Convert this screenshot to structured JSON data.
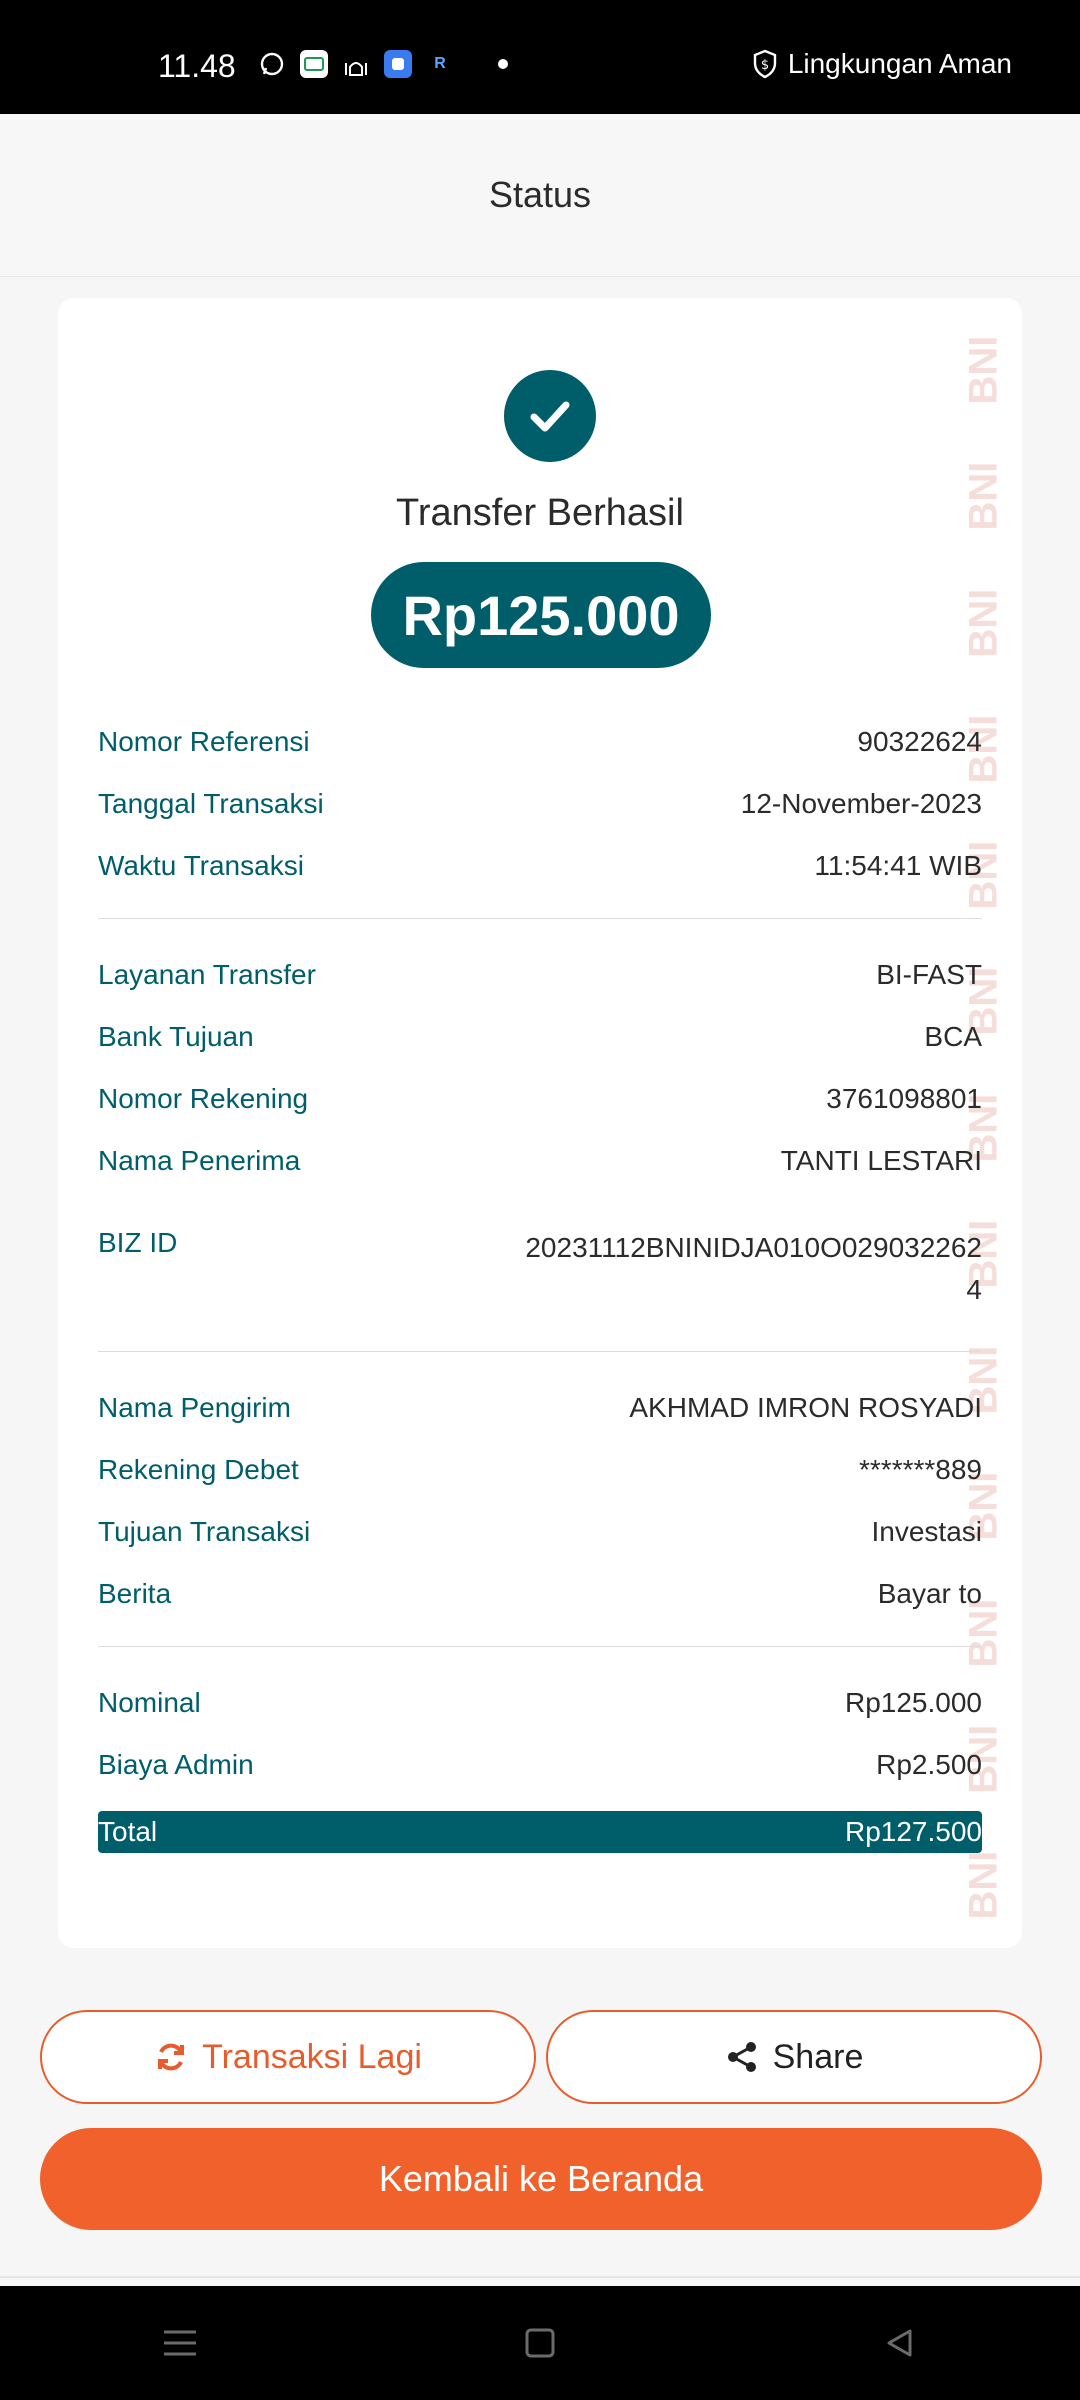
{
  "status_bar": {
    "time": "11.48",
    "right_text": "Lingkungan Aman",
    "icons": [
      "whatsapp-icon",
      "app-icon",
      "mosque-icon",
      "blue-app-icon",
      "r-app-icon"
    ]
  },
  "header": {
    "title": "Status"
  },
  "receipt": {
    "status_title": "Transfer Berhasil",
    "amount": "Rp125.000",
    "watermark": "BNI",
    "section1": [
      {
        "label": "Nomor Referensi",
        "value": "90322624"
      },
      {
        "label": "Tanggal Transaksi",
        "value": "12-November-2023"
      },
      {
        "label": "Waktu Transaksi",
        "value": "11:54:41 WIB"
      }
    ],
    "section2": [
      {
        "label": "Layanan Transfer",
        "value": "BI-FAST"
      },
      {
        "label": "Bank Tujuan",
        "value": "BCA"
      },
      {
        "label": "Nomor Rekening",
        "value": "3761098801"
      },
      {
        "label": "Nama Penerima",
        "value": "TANTI LESTARI"
      },
      {
        "label": "BIZ ID",
        "value": "20231112BNINIDJA010O0290322624"
      }
    ],
    "section3": [
      {
        "label": "Nama Pengirim",
        "value": "AKHMAD IMRON ROSYADI"
      },
      {
        "label": "Rekening Debet",
        "value": "*******889"
      },
      {
        "label": "Tujuan Transaksi",
        "value": "Investasi"
      },
      {
        "label": "Berita",
        "value": "Bayar to"
      }
    ],
    "section4": [
      {
        "label": "Nominal",
        "value": "Rp125.000"
      },
      {
        "label": "Biaya Admin",
        "value": "Rp2.500"
      }
    ],
    "total": {
      "label": "Total",
      "value": "Rp127.500"
    }
  },
  "actions": {
    "again_label": "Transaksi Lagi",
    "share_label": "Share",
    "home_label": "Kembali ke Beranda"
  },
  "colors": {
    "primary": "#005e6a",
    "accent": "#f0612b"
  }
}
